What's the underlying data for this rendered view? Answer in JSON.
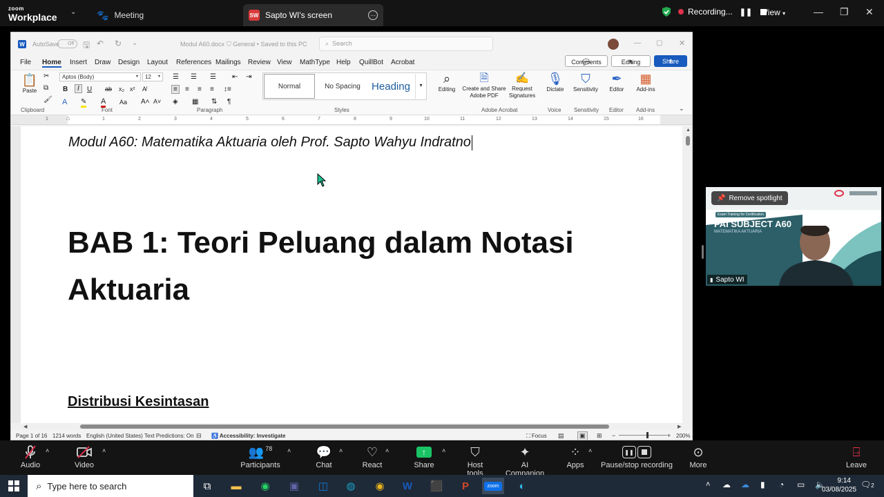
{
  "zoom": {
    "logo_top": "zoom",
    "logo_bottom": "Workplace",
    "tab_meeting": "Meeting",
    "tab_screen_badge": "SW",
    "tab_screen": "Sapto WI's screen",
    "recording": "Recording...",
    "view": "View",
    "controls": {
      "audio": "Audio",
      "video": "Video",
      "participants": "Participants",
      "participants_count": "78",
      "chat": "Chat",
      "react": "React",
      "share": "Share",
      "host_tools": "Host tools",
      "ai_companion": "AI Companion",
      "apps": "Apps",
      "pause_stop": "Pause/stop recording",
      "more": "More",
      "leave": "Leave"
    },
    "video_tile": {
      "spotlight": "Remove spotlight",
      "name": "Sapto WI",
      "slide_title": "PAI SUBJECT A60",
      "slide_subtitle": "MATEMATIKA AKTUARIA",
      "slide_tag": "Exam Training for Certification"
    },
    "colors": {
      "accent": "#0e71eb",
      "share_green": "#19c465",
      "shield_green": "#23a94e",
      "rec_red": "#e0314b"
    }
  },
  "word": {
    "autosave": "AutoSave",
    "autosave_state": "Off",
    "doc_name": "Modul A60.docx",
    "sensitivity": "General",
    "saved": "Saved to this PC",
    "search_placeholder": "Search",
    "menu": [
      "File",
      "Home",
      "Insert",
      "Draw",
      "Design",
      "Layout",
      "References",
      "Mailings",
      "Review",
      "View",
      "MathType",
      "Help",
      "QuillBot",
      "Acrobat"
    ],
    "comments": "Comments",
    "editing_mode": "Editing",
    "share": "Share",
    "font_name": "Aptos (Body)",
    "font_size": "12",
    "paste": "Paste",
    "styles": [
      "Normal",
      "No Spacing",
      "Heading"
    ],
    "editing_btn": "Editing",
    "create_share": "Create and Share Adobe PDF",
    "request_sig": "Request Signatures",
    "dictate": "Dictate",
    "sensitivity_btn": "Sensitivity",
    "editor": "Editor",
    "addins": "Add-ins",
    "groups": [
      "Clipboard",
      "Font",
      "Paragraph",
      "Styles",
      "Adobe Acrobat",
      "Voice",
      "Sensitivity",
      "Editor",
      "Add-ins"
    ],
    "ruler_marks": [
      "1",
      "1",
      "2",
      "3",
      "4",
      "5",
      "6",
      "7",
      "8",
      "9",
      "10",
      "11",
      "12",
      "13",
      "14",
      "15",
      "16"
    ],
    "doc_subtitle": "Modul A60: Matematika Aktuaria oleh Prof. Sapto Wahyu Indratno",
    "doc_heading_1": "BAB 1: Teori Peluang dalam Notasi",
    "doc_heading_2": "Aktuaria",
    "doc_section": "Distribusi Kesintasan",
    "status": {
      "page": "Page 1 of 16",
      "words": "1214 words",
      "lang": "English (United States)",
      "predictions": "Text Predictions: On",
      "accessibility": "Accessibility: Investigate",
      "focus": "Focus",
      "zoom": "200%"
    }
  },
  "taskbar": {
    "search_placeholder": "Type here to search",
    "time": "9:14",
    "date": "03/08/2025",
    "notif_count": "2"
  }
}
